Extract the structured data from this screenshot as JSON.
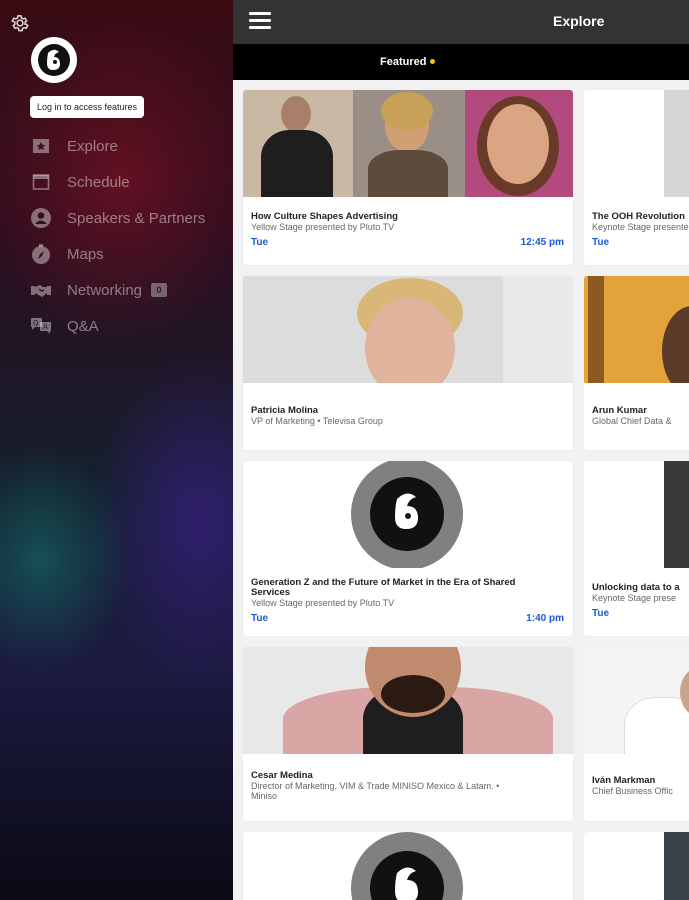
{
  "sidebar": {
    "login_label": "Log in to access features",
    "items": [
      {
        "label": "Explore",
        "icon": "explore-icon"
      },
      {
        "label": "Schedule",
        "icon": "schedule-icon"
      },
      {
        "label": "Speakers & Partners",
        "icon": "speakers-icon"
      },
      {
        "label": "Maps",
        "icon": "maps-icon"
      },
      {
        "label": "Networking",
        "icon": "networking-icon",
        "badge": "0"
      },
      {
        "label": "Q&A",
        "icon": "qa-icon"
      }
    ]
  },
  "header": {
    "title": "Explore"
  },
  "tabs": {
    "featured": "Featured"
  },
  "cards": [
    {
      "title": "How Culture Shapes Advertising",
      "subtitle": "Yellow Stage presented by Pluto TV",
      "day": "Tue",
      "time": "12:45 pm"
    },
    {
      "title": "The OOH Revolution",
      "subtitle": "Keynote Stage presented",
      "day": "Tue"
    },
    {
      "title": "Patricia Molina",
      "subtitle": "VP of Marketing • Televisa Group"
    },
    {
      "title": "Arun Kumar",
      "subtitle": "Global Chief Data &"
    },
    {
      "title": "Generation Z and the Future of Market in the Era of Shared",
      "title2": "Services",
      "subtitle": "Yellow Stage presented by Pluto TV",
      "day": "Tue",
      "time": "1:40 pm"
    },
    {
      "title": "Unlocking data to a",
      "subtitle": "Keynote Stage prese",
      "day": "Tue"
    },
    {
      "title": "Cesar Medina",
      "subtitle": "Director of Marketing, VIM & Trade MINISO Mexico & Latam. •",
      "subtitle2": "Miniso"
    },
    {
      "title": "Iván Markman",
      "subtitle": "Chief Business Offic"
    }
  ],
  "colors": {
    "accent_blue": "#1a5ad8",
    "dot_yellow": "#f5c518",
    "topbar": "#333333"
  }
}
